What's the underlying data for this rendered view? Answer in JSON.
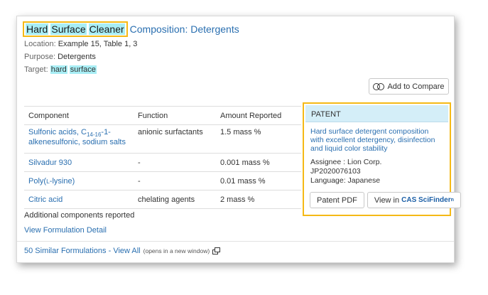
{
  "title": {
    "highlighted_words": [
      "Hard",
      "Surface",
      "Cleaner"
    ],
    "rest": "Composition: Detergents"
  },
  "meta": {
    "location_label": "Location:",
    "location_value": "Example 15, Table 1, 3",
    "purpose_label": "Purpose:",
    "purpose_value": "Detergents",
    "target_label": "Target:",
    "target_words": [
      "hard",
      "surface"
    ]
  },
  "compare_button": {
    "label": "Add to Compare",
    "icon": "compare-circles-icon"
  },
  "table": {
    "headers": [
      "Component",
      "Function",
      "Amount Reported"
    ],
    "rows": [
      {
        "component_pre": "Sulfonic acids, C",
        "component_sub": "14-16",
        "component_post": "-1-alkenesulfonic, sodium salts",
        "function": "anionic surfactants",
        "amount": "1.5 mass %"
      },
      {
        "component": "Silvadur 930",
        "function": "-",
        "amount": "0.001 mass %"
      },
      {
        "component_pre": "Poly(",
        "component_sc": "l",
        "component_post": "-lysine)",
        "function": "-",
        "amount": "0.01 mass %"
      },
      {
        "component": "Citric acid",
        "function": "chelating agents",
        "amount": "2 mass %"
      }
    ]
  },
  "additional_components": "Additional components reported",
  "view_detail_link": "View Formulation Detail",
  "similar": {
    "link": "50 Similar Formulations - View All",
    "note": "(opens in a new window)",
    "icon": "open-new-window-icon"
  },
  "patent": {
    "header": "PATENT",
    "title": "Hard surface detergent composition with excellent detergency, disinfection and liquid color stability",
    "assignee": "Assignee : Lion Corp.",
    "number": "JP2020076103",
    "language": "Language: Japanese",
    "pdf_button": "Patent PDF",
    "view_button_prefix": "View in",
    "view_button_brand": "CAS SciFinder",
    "view_button_suffix": "n"
  },
  "colors": {
    "link": "#2a6fb0",
    "highlight": "#a8eef5",
    "focus_border": "#f5b916",
    "patent_header_bg": "#d4eef8"
  }
}
